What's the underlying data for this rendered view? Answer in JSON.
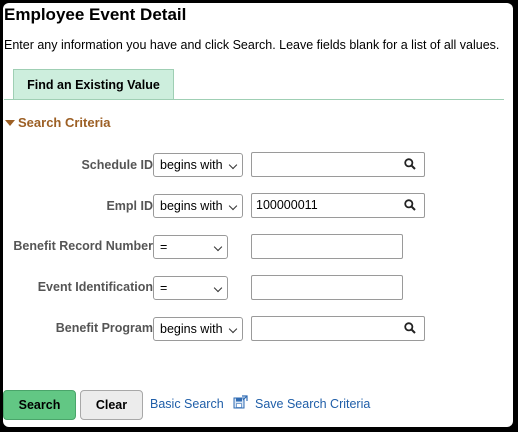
{
  "page": {
    "title": "Employee Event Detail",
    "instructions": "Enter any information you have and click Search. Leave fields blank for a list of all values."
  },
  "tab": {
    "label": "Find an Existing Value"
  },
  "section": {
    "title": "Search Criteria"
  },
  "fields": [
    {
      "label": "Schedule ID",
      "operator": "begins with",
      "value": "",
      "has_prompt": true
    },
    {
      "label": "Empl ID",
      "operator": "begins with",
      "value": "100000011",
      "has_prompt": true
    },
    {
      "label": "Benefit Record Number",
      "operator": "=",
      "value": "",
      "has_prompt": false
    },
    {
      "label": "Event Identification",
      "operator": "=",
      "value": "",
      "has_prompt": false
    },
    {
      "label": "Benefit Program",
      "operator": "begins with",
      "value": "",
      "has_prompt": true
    }
  ],
  "buttons": {
    "search": "Search",
    "clear": "Clear"
  },
  "links": {
    "basic_search": "Basic Search",
    "save_criteria": "Save Search Criteria"
  },
  "colors": {
    "tab_bg": "#cdeedd",
    "section_title": "#9c5f24",
    "search_button": "#62c784",
    "link": "#1f5ea8"
  },
  "icons": {
    "prompt": "magnifier-icon",
    "save": "save-criteria-icon",
    "section_toggle": "triangle-down-icon",
    "dropdown": "chevron-down-icon"
  }
}
